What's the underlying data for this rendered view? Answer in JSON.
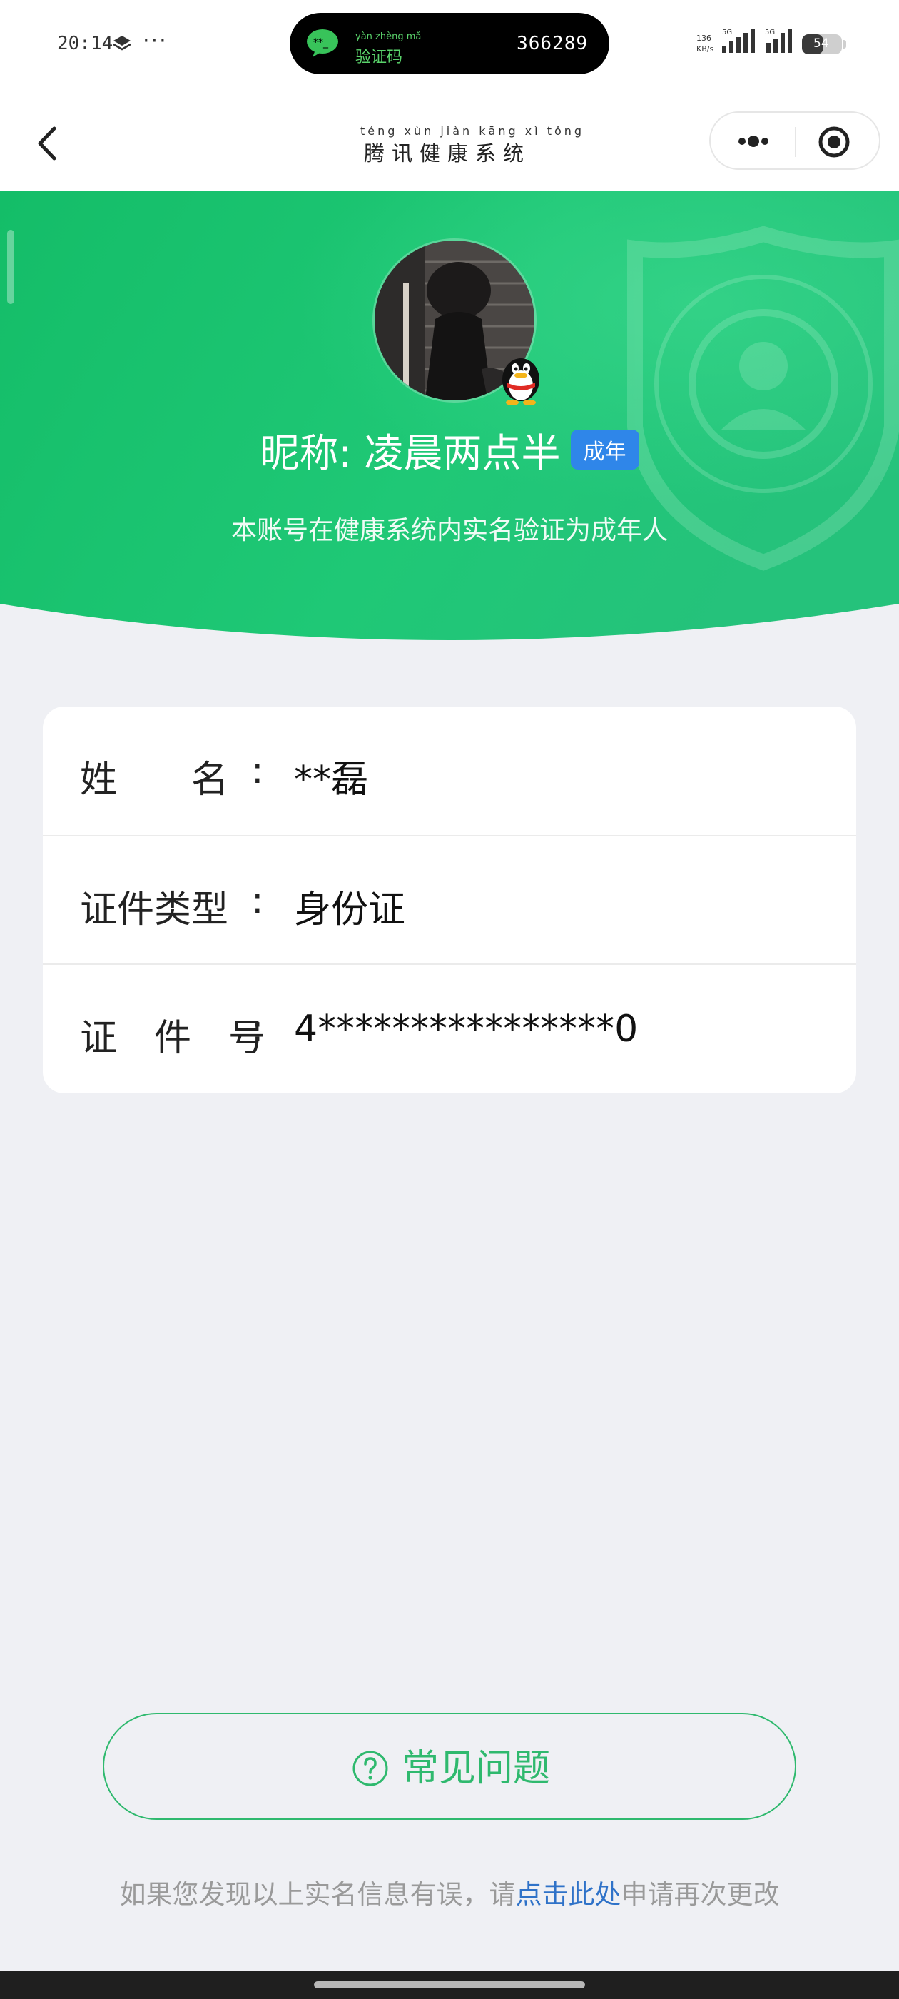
{
  "status_bar": {
    "time": "20:14",
    "network_speed_top": "136",
    "network_speed_unit": "KB/s",
    "signal_label_1": "5G",
    "signal_label_2": "5G",
    "battery": "54",
    "sms_notice": {
      "pinyin": "yàn zhèng mǎ",
      "label": "验证码",
      "code": "366289",
      "icon": "wechat-message-icon"
    }
  },
  "nav": {
    "title_pinyin": "téng xùn jiàn kāng xì tǒng",
    "title": "腾讯健康系统",
    "back_icon": "chevron-left-icon",
    "more_icon": "more-dots-icon",
    "close_icon": "target-close-icon"
  },
  "profile": {
    "nickname": "昵称: 凌晨两点半",
    "badge": "成年",
    "description": "本账号在健康系统内实名验证为成年人",
    "platform_icon": "qq-penguin-icon"
  },
  "info": {
    "rows": [
      {
        "label": "姓　　名",
        "value": "**磊"
      },
      {
        "label": "证件类型",
        "value": "身份证"
      },
      {
        "label": "证　件　号",
        "value": "4****************0"
      }
    ],
    "colon": ":"
  },
  "faq": {
    "label": "常见问题",
    "icon": "question-circle-icon"
  },
  "footer": {
    "prefix": "如果您发现以上实名信息有误，请",
    "link": "点击此处",
    "suffix": "申请再次更改"
  },
  "colors": {
    "brand_green": "#1fbf71",
    "badge_blue": "#2f86e9",
    "link_blue": "#2f72c8",
    "background": "#eff0f4"
  }
}
